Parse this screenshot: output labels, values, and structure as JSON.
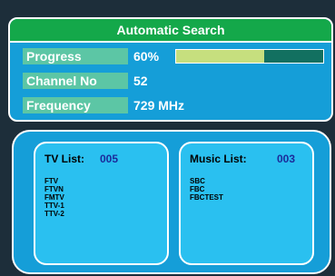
{
  "panel": {
    "title": "Automatic Search",
    "progress": {
      "label": "Progress",
      "value_text": "60%",
      "fraction": 0.6
    },
    "channel": {
      "label": "Channel No",
      "value": "52"
    },
    "frequency": {
      "label": "Frequency",
      "value": "729 MHz"
    }
  },
  "lists": {
    "tv": {
      "label": "TV List:",
      "count": "005",
      "items": [
        "FTV",
        "FTVN",
        "FMTV",
        "TTV-1",
        "TTV-2"
      ]
    },
    "music": {
      "label": "Music List:",
      "count": "003",
      "items": [
        "SBC",
        "FBC",
        "FBCTEST"
      ]
    }
  },
  "colors": {
    "panel_bg": "#159ed8",
    "title_bar": "#14a84a",
    "label_bg": "#5cc6a5",
    "progress_fill": "#c6df7e",
    "progress_track": "#127060",
    "list_bg": "#2ac0f0",
    "count_text": "#1b2a9a"
  }
}
